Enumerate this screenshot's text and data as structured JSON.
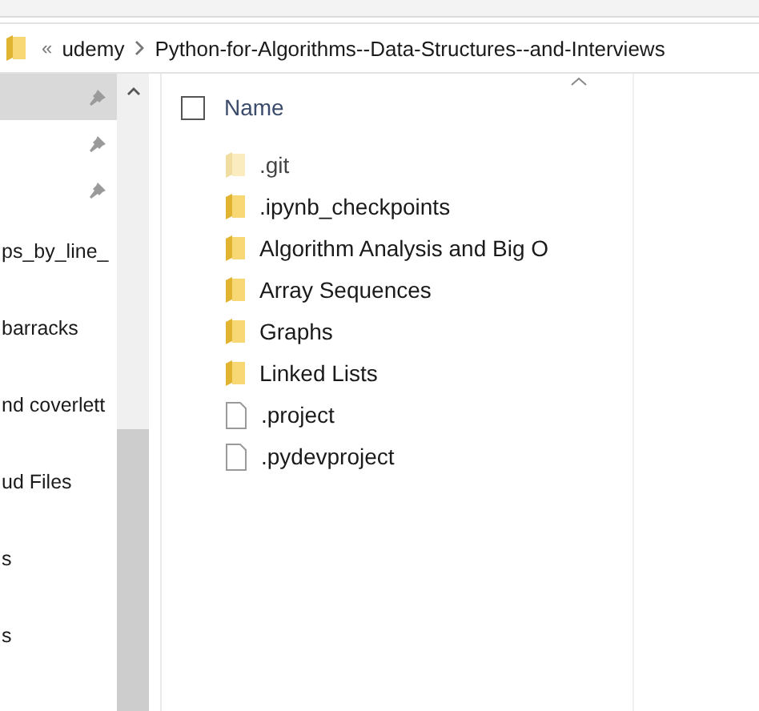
{
  "address_bar": {
    "overflow": "«",
    "crumbs": [
      "udemy",
      "Python-for-Algorithms--Data-Structures--and-Interviews"
    ]
  },
  "nav_pane": {
    "items": [
      {
        "selected": true,
        "pinned": true
      },
      {
        "selected": false,
        "pinned": true
      },
      {
        "selected": false,
        "pinned": true
      },
      {
        "selected": false,
        "pinned": false,
        "label": "ps_by_line_"
      },
      {
        "selected": false,
        "pinned": false,
        "label": "barracks"
      },
      {
        "selected": false,
        "pinned": false,
        "label": "nd coverlett"
      },
      {
        "selected": false,
        "pinned": false,
        "label": "ud Files"
      },
      {
        "selected": false,
        "pinned": false,
        "label": "s"
      },
      {
        "selected": false,
        "pinned": false,
        "label": "s"
      }
    ]
  },
  "file_list": {
    "column": "Name",
    "select_all_checked": false,
    "items": [
      {
        "name": ".git",
        "kind": "folder",
        "hidden": true
      },
      {
        "name": ".ipynb_checkpoints",
        "kind": "folder",
        "hidden": false
      },
      {
        "name": "Algorithm Analysis and Big O",
        "kind": "folder",
        "hidden": false
      },
      {
        "name": "Array Sequences",
        "kind": "folder",
        "hidden": false
      },
      {
        "name": "Graphs",
        "kind": "folder",
        "hidden": false
      },
      {
        "name": "Linked Lists",
        "kind": "folder",
        "hidden": false
      },
      {
        "name": ".project",
        "kind": "file",
        "hidden": false
      },
      {
        "name": ".pydevproject",
        "kind": "file",
        "hidden": false
      }
    ]
  }
}
